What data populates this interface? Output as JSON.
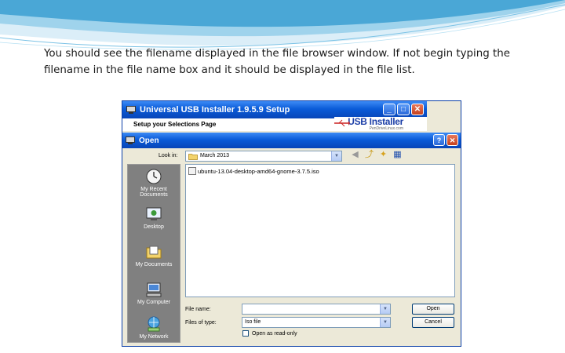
{
  "slide": {
    "instruction": "You should see the filename displayed in the file browser window. If not begin typing the filename in the file name box and it should be displayed in the file list."
  },
  "installer": {
    "title": "Universal USB Installer 1.9.5.9 Setup",
    "subtitle": "Setup your Selections Page",
    "logo_text": "USB Installer",
    "logo_site": "PenDriveLinux.com"
  },
  "dialog": {
    "title": "Open",
    "look_in_label": "Look in:",
    "look_in_value": "March 2013",
    "places": [
      {
        "label": "My Recent Documents",
        "icon": "recent-documents-icon"
      },
      {
        "label": "Desktop",
        "icon": "desktop-icon"
      },
      {
        "label": "My Documents",
        "icon": "my-documents-icon"
      },
      {
        "label": "My Computer",
        "icon": "my-computer-icon"
      },
      {
        "label": "My Network",
        "icon": "my-network-icon"
      }
    ],
    "files": [
      "ubuntu-13.04-desktop-amd64-gnome-3.7.5.iso"
    ],
    "file_name_label": "File name:",
    "file_name_value": "",
    "file_type_label": "Files of type:",
    "file_type_value": "Iso file",
    "open_label": "Open",
    "cancel_label": "Cancel",
    "readonly_label": "Open as read-only"
  },
  "colors": {
    "titlebar": "#0a5bd8",
    "dialog_bg": "#ece9d8",
    "places_bg": "#808080"
  }
}
